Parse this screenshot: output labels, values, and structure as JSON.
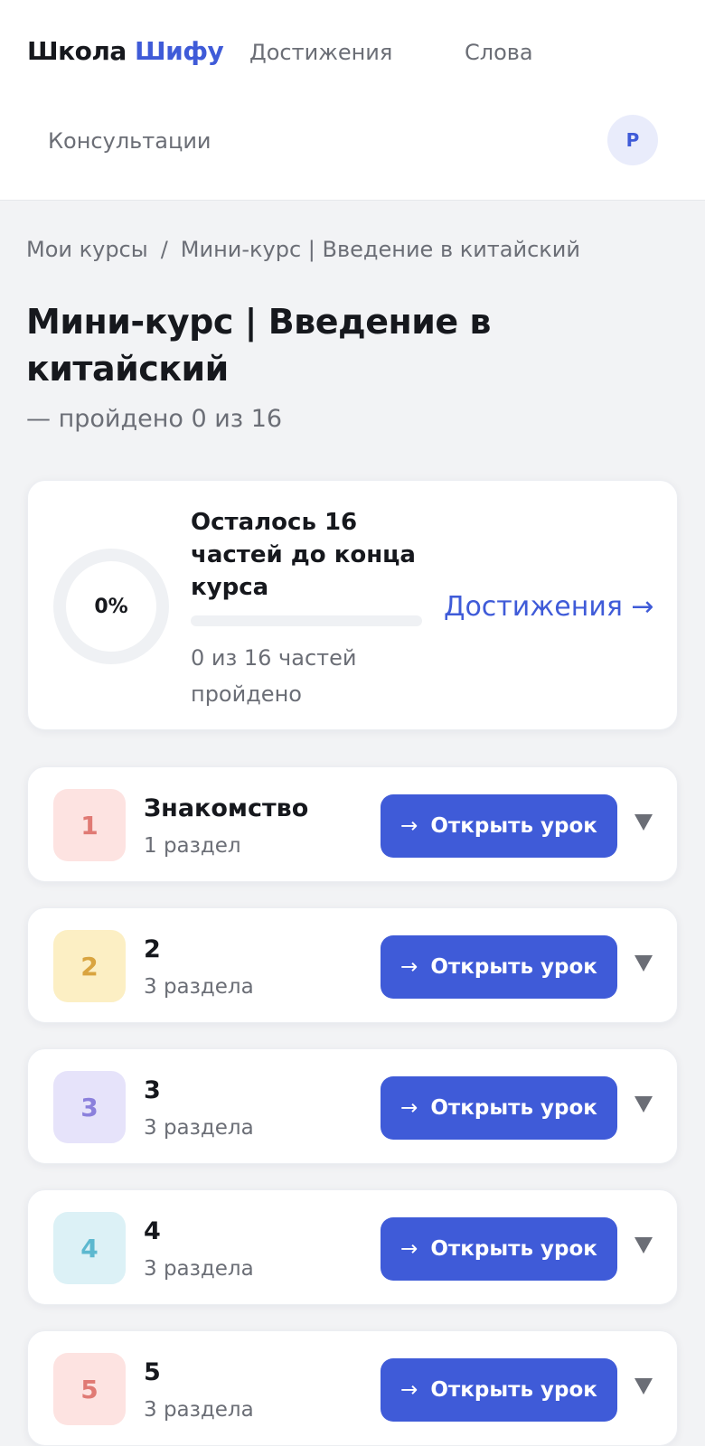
{
  "header": {
    "logo_main": "Школа",
    "logo_accent": "Шифу",
    "nav": [
      "Достижения",
      "Слова",
      "Консультации"
    ],
    "avatar_initial": "Р"
  },
  "breadcrumb": {
    "root": "Мои курсы",
    "separator": "/",
    "current": "Мини-курс | Введение в китайский"
  },
  "course": {
    "title": "Мини-курс | Введение в китайский",
    "progress_subtitle": "— пройдено 0 из 16"
  },
  "progress_card": {
    "percent_label": "0%",
    "progress_fraction": 0,
    "remaining": "Осталось 16 частей до конца курса",
    "parts_done": "0 из 16 частей пройдено",
    "achievements_link": "Достижения →"
  },
  "lesson_button_label": "Открыть урок",
  "lesson_button_arrow": "→",
  "lessons": [
    {
      "number": "1",
      "title": "Знакомство",
      "meta": "1 раздел",
      "badge_bg": "#fde3e1",
      "badge_color": "#e07a74"
    },
    {
      "number": "2",
      "title": "2",
      "meta": "3 раздела",
      "badge_bg": "#fcefc4",
      "badge_color": "#d9a43f"
    },
    {
      "number": "3",
      "title": "3",
      "meta": "3 раздела",
      "badge_bg": "#e6e3fa",
      "badge_color": "#8b80dc"
    },
    {
      "number": "4",
      "title": "4",
      "meta": "3 раздела",
      "badge_bg": "#dcf1f6",
      "badge_color": "#5cb8cf"
    },
    {
      "number": "5",
      "title": "5",
      "meta": "3 раздела",
      "badge_bg": "#fde3e1",
      "badge_color": "#e07a74"
    }
  ],
  "colors": {
    "accent": "#3f5bd8",
    "background": "#f2f3f5",
    "muted_text": "#6b6e76"
  }
}
